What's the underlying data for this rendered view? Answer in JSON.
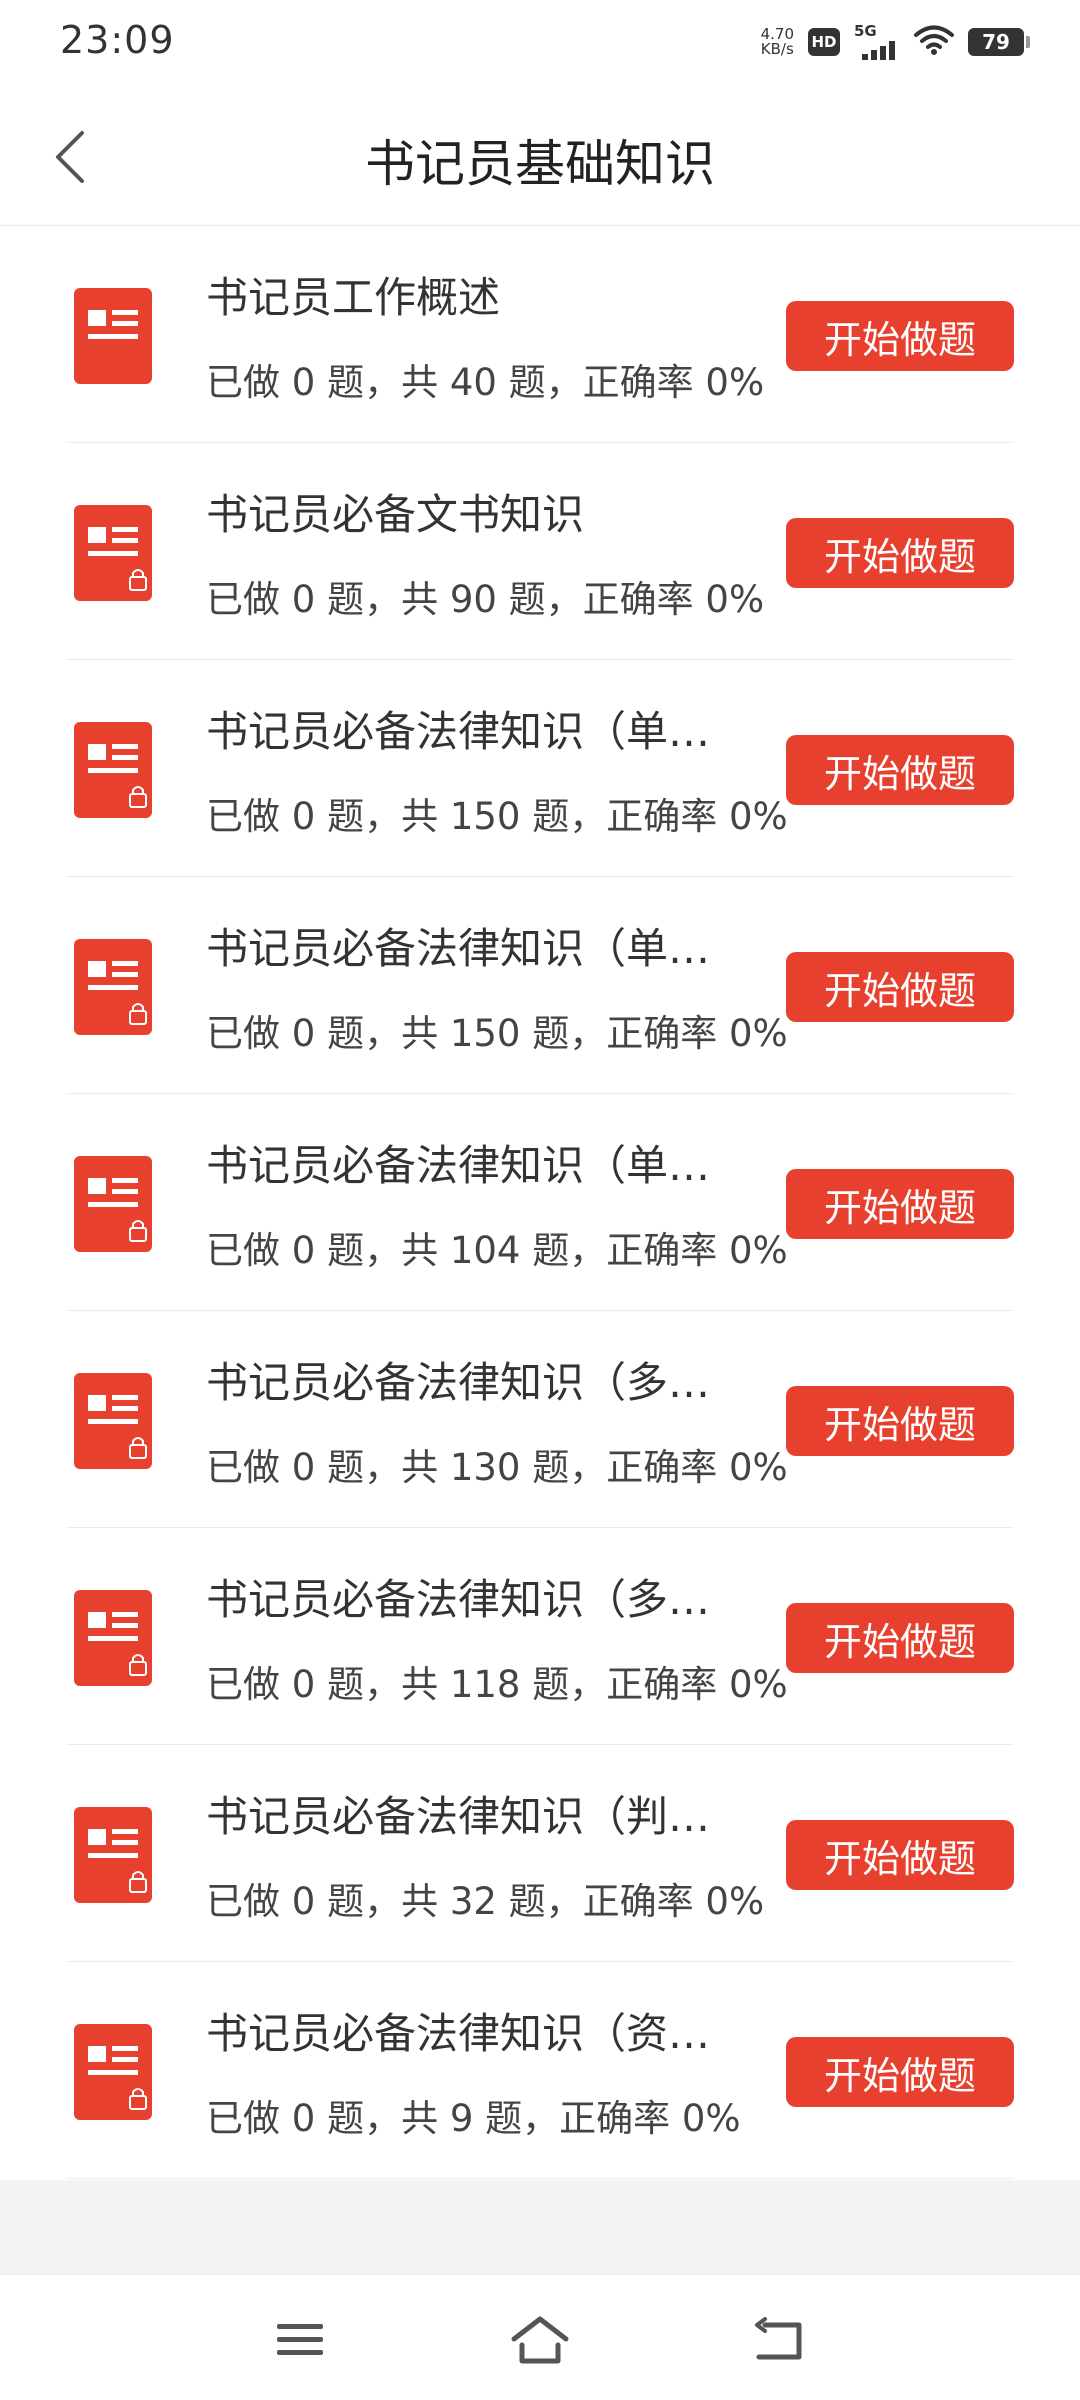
{
  "status_bar": {
    "time": "23:09",
    "net_speed_value": "4.70",
    "net_speed_unit": "KB/s",
    "hd_label": "HD",
    "network_label": "5G",
    "battery": "79"
  },
  "header": {
    "title": "书记员基础知识",
    "back_icon": "chevron-left-icon"
  },
  "list": {
    "items": [
      {
        "title": "书记员工作概述",
        "stats": "已做 0 题，共 40 题，正确率 0%",
        "button": "开始做题",
        "locked": false
      },
      {
        "title": "书记员必备文书知识",
        "stats": "已做 0 题，共 90 题，正确率 0%",
        "button": "开始做题",
        "locked": true
      },
      {
        "title": "书记员必备法律知识（单…",
        "stats": "已做 0 题，共 150 题，正确率 0%",
        "button": "开始做题",
        "locked": true
      },
      {
        "title": "书记员必备法律知识（单…",
        "stats": "已做 0 题，共 150 题，正确率 0%",
        "button": "开始做题",
        "locked": true
      },
      {
        "title": "书记员必备法律知识（单…",
        "stats": "已做 0 题，共 104 题，正确率 0%",
        "button": "开始做题",
        "locked": true
      },
      {
        "title": "书记员必备法律知识（多…",
        "stats": "已做 0 题，共 130 题，正确率 0%",
        "button": "开始做题",
        "locked": true
      },
      {
        "title": "书记员必备法律知识（多…",
        "stats": "已做 0 题，共 118 题，正确率 0%",
        "button": "开始做题",
        "locked": true
      },
      {
        "title": "书记员必备法律知识（判…",
        "stats": "已做 0 题，共 32 题，正确率 0%",
        "button": "开始做题",
        "locked": true
      },
      {
        "title": "书记员必备法律知识（资…",
        "stats": "已做 0 题，共 9 题，正确率 0%",
        "button": "开始做题",
        "locked": true
      }
    ]
  },
  "colors": {
    "accent": "#e8402e",
    "text": "#333333",
    "divider": "#ececec"
  },
  "nav_bar": {
    "icons": [
      "menu-icon",
      "home-icon",
      "back-icon"
    ]
  }
}
